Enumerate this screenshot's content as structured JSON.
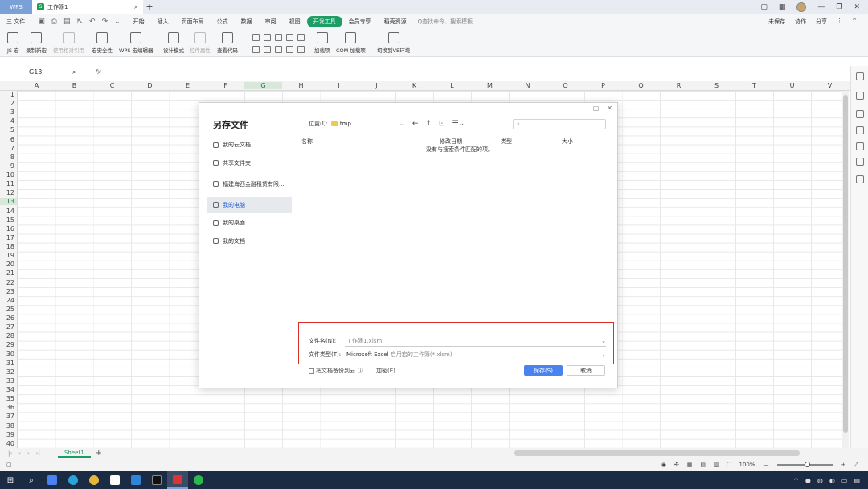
{
  "titlebar": {
    "app": "WPS",
    "doc_tab": "工作簿1"
  },
  "menubar": {
    "file": "三 文件",
    "items": [
      "开始",
      "插入",
      "页面布局",
      "公式",
      "数据",
      "审阅",
      "视图",
      "开发工具",
      "会员专享",
      "稻壳资源"
    ],
    "active_index": 7,
    "search": "Q查找命令、搜索模板",
    "unsaved": "未保存",
    "collab": "协作",
    "share": "分享"
  },
  "ribbon": {
    "js_macro": "JS 宏",
    "record_macro": "录制新宏",
    "relative_ref": "使用相对引用",
    "macro_security": "宏安全性",
    "wps_macro_editor": "WPS 宏编辑器",
    "design_mode": "设计模式",
    "control_props": "控件属性",
    "view_code": "查看代码",
    "addins": "加载项",
    "com_addins": "COM 加载项",
    "switch_vb": "切换到VB环境"
  },
  "formula": {
    "cellref": "G13",
    "fx": "fx"
  },
  "columns": [
    "A",
    "B",
    "C",
    "D",
    "E",
    "F",
    "G",
    "H",
    "I",
    "J",
    "K",
    "L",
    "M",
    "N",
    "O",
    "P",
    "Q",
    "R",
    "S",
    "T",
    "U",
    "V"
  ],
  "selected_col": "G",
  "rows": [
    "1",
    "2",
    "3",
    "4",
    "5",
    "6",
    "7",
    "8",
    "9",
    "10",
    "11",
    "12",
    "13",
    "14",
    "15",
    "16",
    "17",
    "18",
    "19",
    "20",
    "21",
    "22",
    "23",
    "24",
    "25",
    "26",
    "27",
    "28",
    "29",
    "30",
    "31",
    "32",
    "33",
    "34",
    "35",
    "36",
    "37",
    "38",
    "39",
    "40"
  ],
  "selected_row": "13",
  "sheet": {
    "name": "Sheet1",
    "add": "+"
  },
  "status": {
    "zoom": "100%"
  },
  "dialog": {
    "title": "另存文件",
    "nav": [
      {
        "label": "我的云文档",
        "icon": "cloud-icon"
      },
      {
        "label": "共享文件夹",
        "icon": "share-folder-icon"
      },
      {
        "label": "福建海西金融租赁有限...",
        "icon": "building-icon"
      },
      {
        "label": "我的电脑",
        "icon": "computer-icon"
      },
      {
        "label": "我的桌面",
        "icon": "desktop-icon"
      },
      {
        "label": "我的文档",
        "icon": "document-icon"
      }
    ],
    "location_label": "位置(I):",
    "location": "tmp",
    "columns": {
      "name": "名称",
      "modified": "修改日期",
      "type": "类型",
      "size": "大小"
    },
    "empty_message": "没有与搜索条件匹配的项。",
    "filename_label": "文件名(N):",
    "filename": "工作簿1.xlsm",
    "filetype_label": "文件类型(T):",
    "filetype_main": "Microsoft Excel",
    "filetype_sub": "启用宏的工作簿(*.xlsm)",
    "backup_label": "把文档备份到云",
    "encrypt_label": "加密(E)...",
    "save_button": "保存(S)",
    "cancel_button": "取消"
  }
}
